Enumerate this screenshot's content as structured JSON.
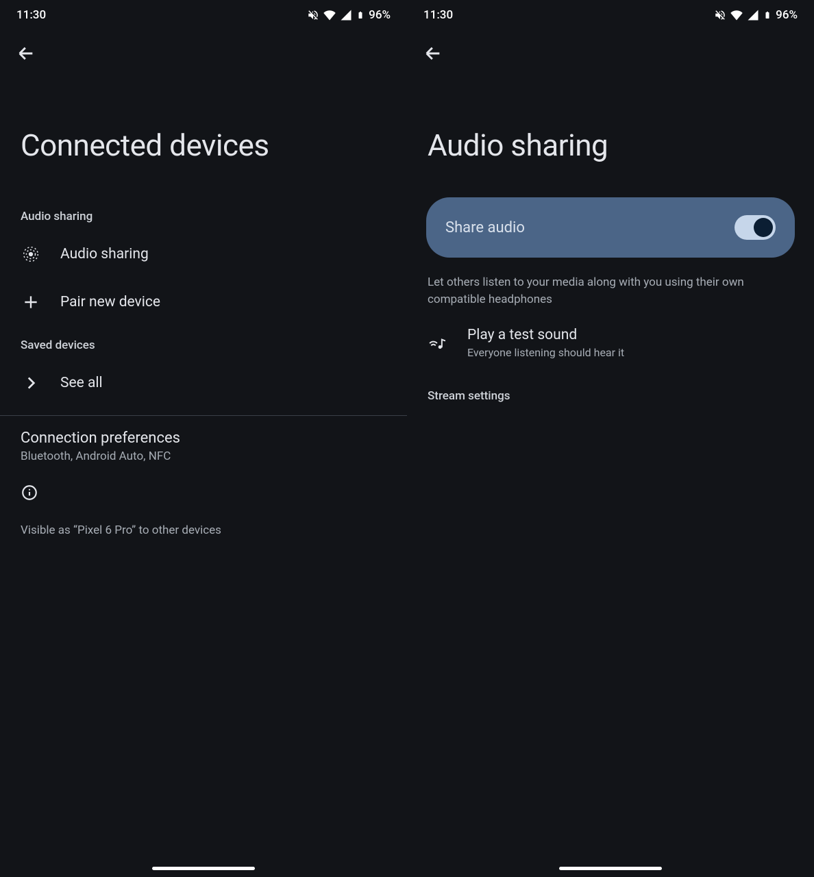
{
  "statusBar": {
    "time": "11:30",
    "battery": "96%"
  },
  "left": {
    "title": "Connected devices",
    "section_audio": "Audio sharing",
    "item_audio_sharing": "Audio sharing",
    "item_pair_new": "Pair new device",
    "section_saved": "Saved devices",
    "item_see_all": "See all",
    "pref_title": "Connection preferences",
    "pref_sub": "Bluetooth, Android Auto, NFC",
    "visible_text": "Visible as “Pixel 6 Pro” to other devices"
  },
  "right": {
    "title": "Audio sharing",
    "toggle_label": "Share audio",
    "toggle_on": true,
    "desc": "Let others listen to your media along with you using their own compatible headphones",
    "test_title": "Play a test sound",
    "test_sub": "Everyone listening should hear it",
    "section_stream": "Stream settings"
  }
}
